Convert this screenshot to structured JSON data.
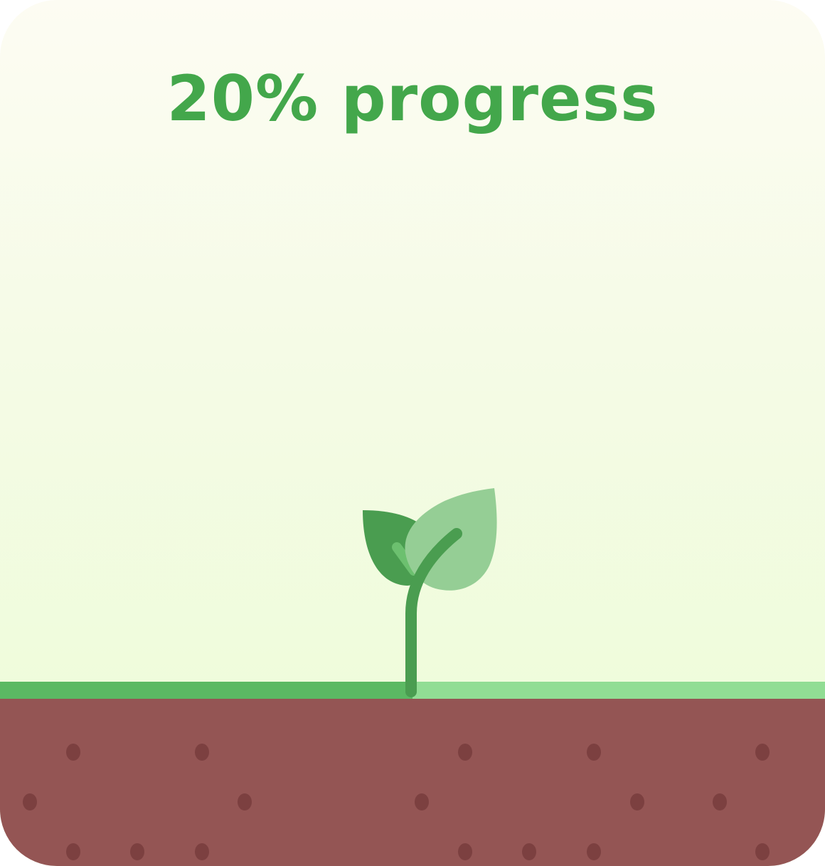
{
  "title": "20% progress",
  "progress": {
    "value": 0.2,
    "percent": 20
  },
  "colors": {
    "title": "#43a74b",
    "grass_filled": "#5bb963",
    "grass_remaining": "#91dd94",
    "soil": "#945554",
    "soil_dots": "#7c4040",
    "stem": "#4a9d50",
    "leaf_dark": "#4a9d50",
    "leaf_light": "#95ce95",
    "leaf_vein": "#6cc06f"
  },
  "icons": {
    "plant": "sprout-icon"
  }
}
